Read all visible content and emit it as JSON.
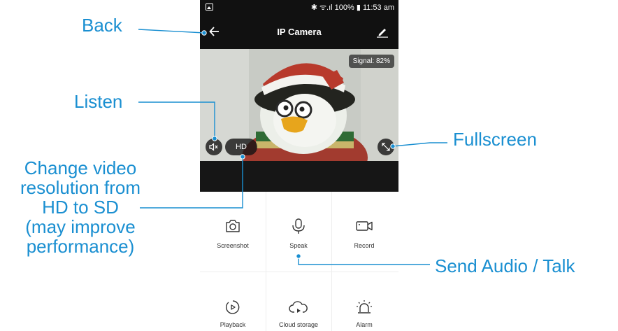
{
  "statusbar": {
    "right": "✱ ᯤ.ıl 100% ▮ 11:53 am"
  },
  "appbar": {
    "title": "IP Camera"
  },
  "video": {
    "signal": "Signal: 82%",
    "hd": "HD"
  },
  "grid": {
    "items": [
      {
        "label": "Screenshot",
        "icon": "camera-icon"
      },
      {
        "label": "Speak",
        "icon": "microphone-icon"
      },
      {
        "label": "Record",
        "icon": "video-camera-icon"
      },
      {
        "label": "Playback",
        "icon": "playback-icon"
      },
      {
        "label": "Cloud storage",
        "icon": "cloud-storage-icon"
      },
      {
        "label": "Alarm",
        "icon": "alarm-icon"
      }
    ]
  },
  "annotations": {
    "back": "Back",
    "listen": "Listen",
    "fullscreen": "Fullscreen",
    "resolution": [
      "Change video",
      "resolution from",
      "HD to SD",
      "(may improve",
      "performance)"
    ],
    "speak": "Send Audio / Talk"
  },
  "colors": {
    "annotation": "#1a8fd1",
    "bar": "#111111"
  }
}
